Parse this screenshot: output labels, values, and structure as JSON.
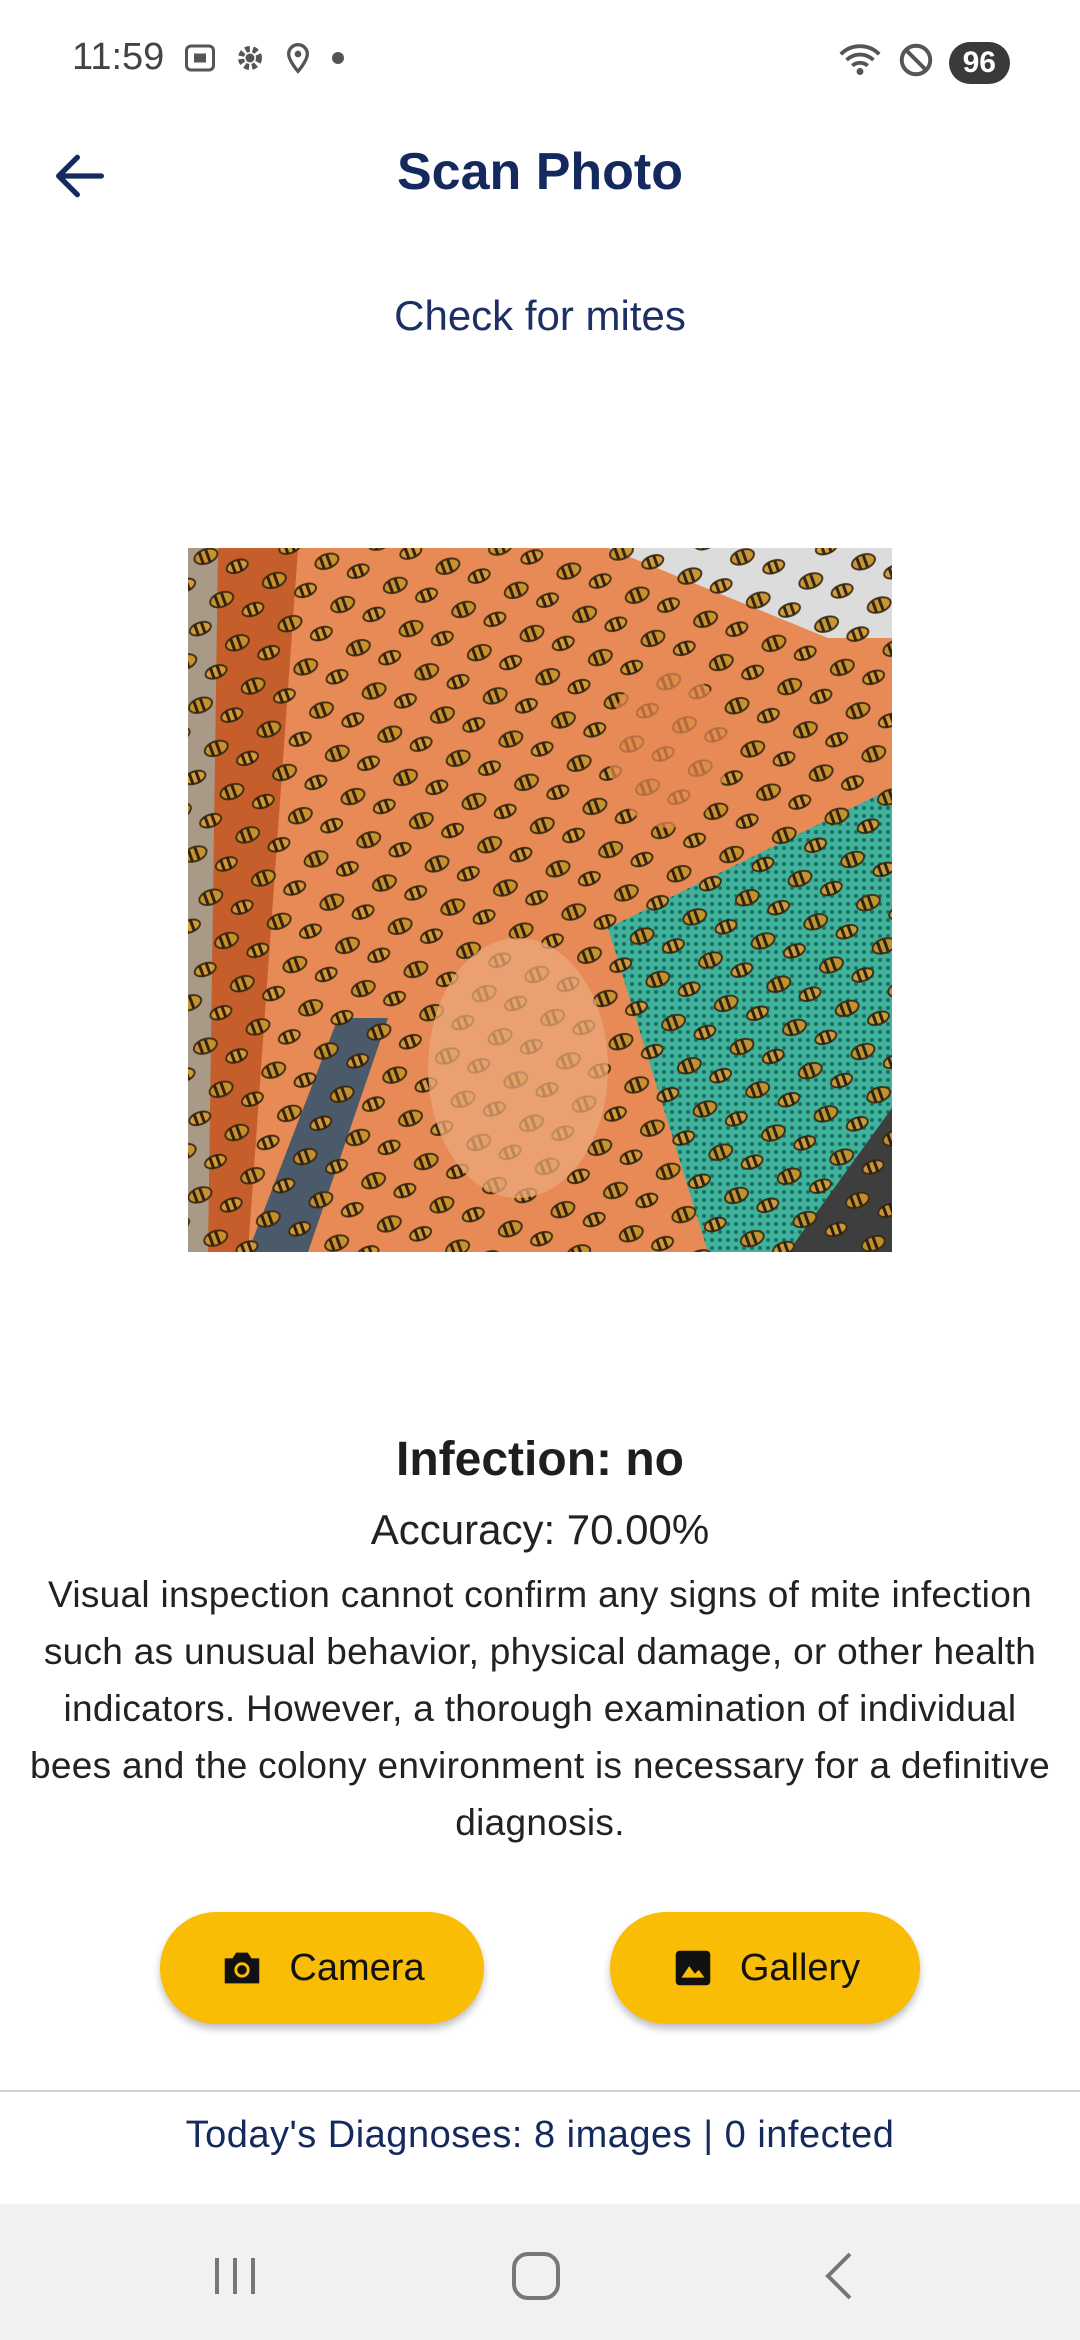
{
  "status_bar": {
    "time": "11:59",
    "battery": "96",
    "icons_left": [
      "screenshot-icon",
      "gear-icon",
      "location-icon",
      "dot-icon"
    ],
    "icons_right": [
      "wifi-icon",
      "do-not-disturb-icon"
    ]
  },
  "app_bar": {
    "title": "Scan Photo",
    "back_icon": "arrow-left-icon"
  },
  "subtitle": "Check for mites",
  "photo": {
    "subject": "bee-hive-photo"
  },
  "result": {
    "title": "Infection: no",
    "accuracy": "Accuracy: 70.00%",
    "description": "Visual inspection cannot confirm any signs of mite infection such as unusual behavior, physical damage, or other health indicators. However, a thorough examination of individual bees and the colony environment is necessary for a definitive diagnosis."
  },
  "buttons": {
    "camera_label": "Camera",
    "gallery_label": "Gallery"
  },
  "footer": {
    "diagnoses": "Today's Diagnoses: 8 images | 0 infected"
  },
  "colors": {
    "accent": "#f9bd05",
    "title": "#142a5e"
  }
}
